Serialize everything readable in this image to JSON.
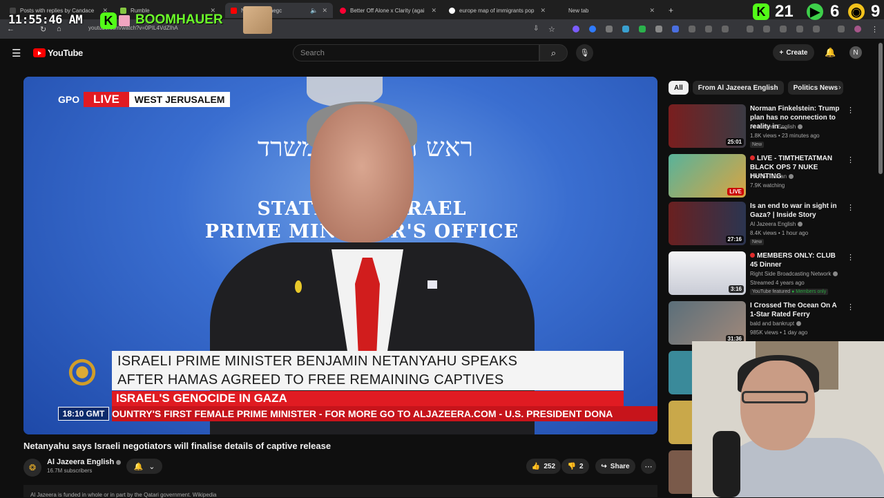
{
  "browser": {
    "tabs": [
      {
        "label": "Posts with replies by Candace",
        "icon": "x-icon",
        "color": "#222222"
      },
      {
        "label": "Rumble",
        "icon": "rumble-icon",
        "color": "#85c742"
      },
      {
        "label": "N ys Israeli negc",
        "icon": "youtube-icon",
        "color": "#ff0000"
      },
      {
        "label": "Better Off Alone x Clarity (agai",
        "icon": "youtube-music-icon",
        "color": "#ff0033"
      },
      {
        "label": "europe map of immigrants pop",
        "icon": "google-icon",
        "color": "#4285f4"
      },
      {
        "label": "New tab",
        "icon": "new-tab-icon",
        "color": "#777777"
      }
    ],
    "url": "youtube.com/watch?v=0PIL4VdZIhA"
  },
  "overlay": {
    "clock": "11:55:46 AM",
    "streamer": "BOOMHAUER",
    "stat1": "21",
    "stat2": "6",
    "stat3": "9"
  },
  "header": {
    "logo": "YouTube",
    "search_placeholder": "Search",
    "create_label": "Create"
  },
  "player": {
    "live": "LIVE",
    "location": "WEST JERUSALEM",
    "gpo": "GPO",
    "wall_line1": "ראש הממשלה משרד",
    "wall_line2a": "STATE",
    "wall_line2b": "ISRAEL",
    "wall_line3": "PRIME MINISTER'S OFFICE",
    "headline1": "ISRAELI PRIME MINISTER BENJAMIN NETANYAHU SPEAKS",
    "headline2": "AFTER HAMAS AGREED TO FREE REMAINING CAPTIVES",
    "subhead": "ISRAEL'S GENOCIDE IN GAZA",
    "ticker": "OUNTRY'S FIRST FEMALE PRIME MINISTER   -   FOR MORE GO TO ALJAZEERA.COM   -   U.S. PRESIDENT DONA",
    "time": "18:10 GMT"
  },
  "video": {
    "title": "Netanyahu says Israeli negotiators will finalise details of captive release",
    "channel": "Al Jazeera English",
    "subscribers": "16.7M subscribers",
    "likes": "252",
    "dislikes": "2",
    "share": "Share",
    "notice": "Al Jazeera is funded in whole or in part by the Qatari government. Wikipedia"
  },
  "chips": [
    "All",
    "From Al Jazeera English",
    "Politics News"
  ],
  "recommendations": [
    {
      "title": "Norman Finkelstein: Trump plan has no connection to reality in ...",
      "channel": "Al Jazeera English",
      "meta": "1.8K views • 23 minutes ago",
      "badge": "New",
      "duration": "25:01",
      "live": false,
      "thumb": "#6a3a30"
    },
    {
      "title": "LIVE - TIMTHETATMAN BLACK OPS 7 NUKE HUNTING",
      "channel": "TimTheTatman",
      "meta": "7.9K watching",
      "badge": "",
      "duration": "LIVE",
      "live": true,
      "thumb": "#4e8a7a"
    },
    {
      "title": "Is an end to war in sight in Gaza? | Inside Story",
      "channel": "Al Jazeera English",
      "meta": "8.4K views • 1 hour ago",
      "badge": "New",
      "duration": "27:16",
      "live": false,
      "thumb": "#3a4a6a"
    },
    {
      "title": "MEMBERS ONLY: CLUB 45 Dinner",
      "channel": "Right Side Broadcasting Network",
      "meta": "Streamed 4 years ago",
      "badge": "YouTube featured",
      "extra": "Members only",
      "duration": "3:16",
      "live": false,
      "thumb": "#e8e8ec"
    },
    {
      "title": "I Crossed The Ocean On A 1-Star Rated Ferry",
      "channel": "bald and bankrupt",
      "meta": "985K views • 1 day ago",
      "badge": "",
      "duration": "31:36",
      "live": false,
      "thumb": "#6e7c80"
    }
  ]
}
